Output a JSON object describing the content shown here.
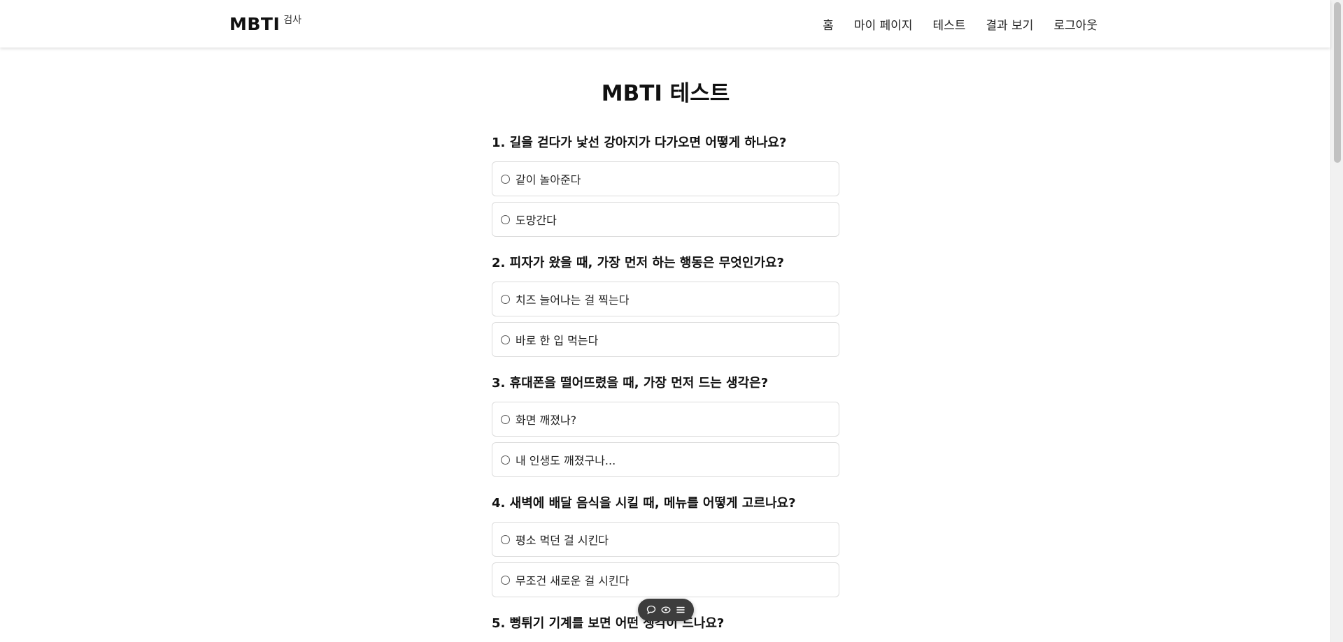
{
  "header": {
    "logo_main": "MBTI",
    "logo_sub": "검사",
    "nav": [
      "홈",
      "마이 페이지",
      "테스트",
      "결과 보기",
      "로그아웃"
    ]
  },
  "main": {
    "title": "MBTI 테스트",
    "questions": [
      {
        "text": "1. 길을 걷다가 낯선 강아지가 다가오면 어떻게 하나요?",
        "options": [
          "같이 놀아준다",
          "도망간다"
        ]
      },
      {
        "text": "2. 피자가 왔을 때, 가장 먼저 하는 행동은 무엇인가요?",
        "options": [
          "치즈 늘어나는 걸 찍는다",
          "바로 한 입 먹는다"
        ]
      },
      {
        "text": "3. 휴대폰을 떨어뜨렸을 때, 가장 먼저 드는 생각은?",
        "options": [
          "화면 깨졌나?",
          "내 인생도 깨졌구나..."
        ]
      },
      {
        "text": "4. 새벽에 배달 음식을 시킬 때, 메뉴를 어떻게 고르나요?",
        "options": [
          "평소 먹던 걸 시킨다",
          "무조건 새로운 걸 시킨다"
        ]
      },
      {
        "text": "5. 뻥튀기 기계를 보면 어떤 생각이 드나요?",
        "options": []
      }
    ]
  },
  "floating_toolbar": {
    "icons": [
      "comment-icon",
      "eye-icon",
      "menu-icon"
    ]
  }
}
